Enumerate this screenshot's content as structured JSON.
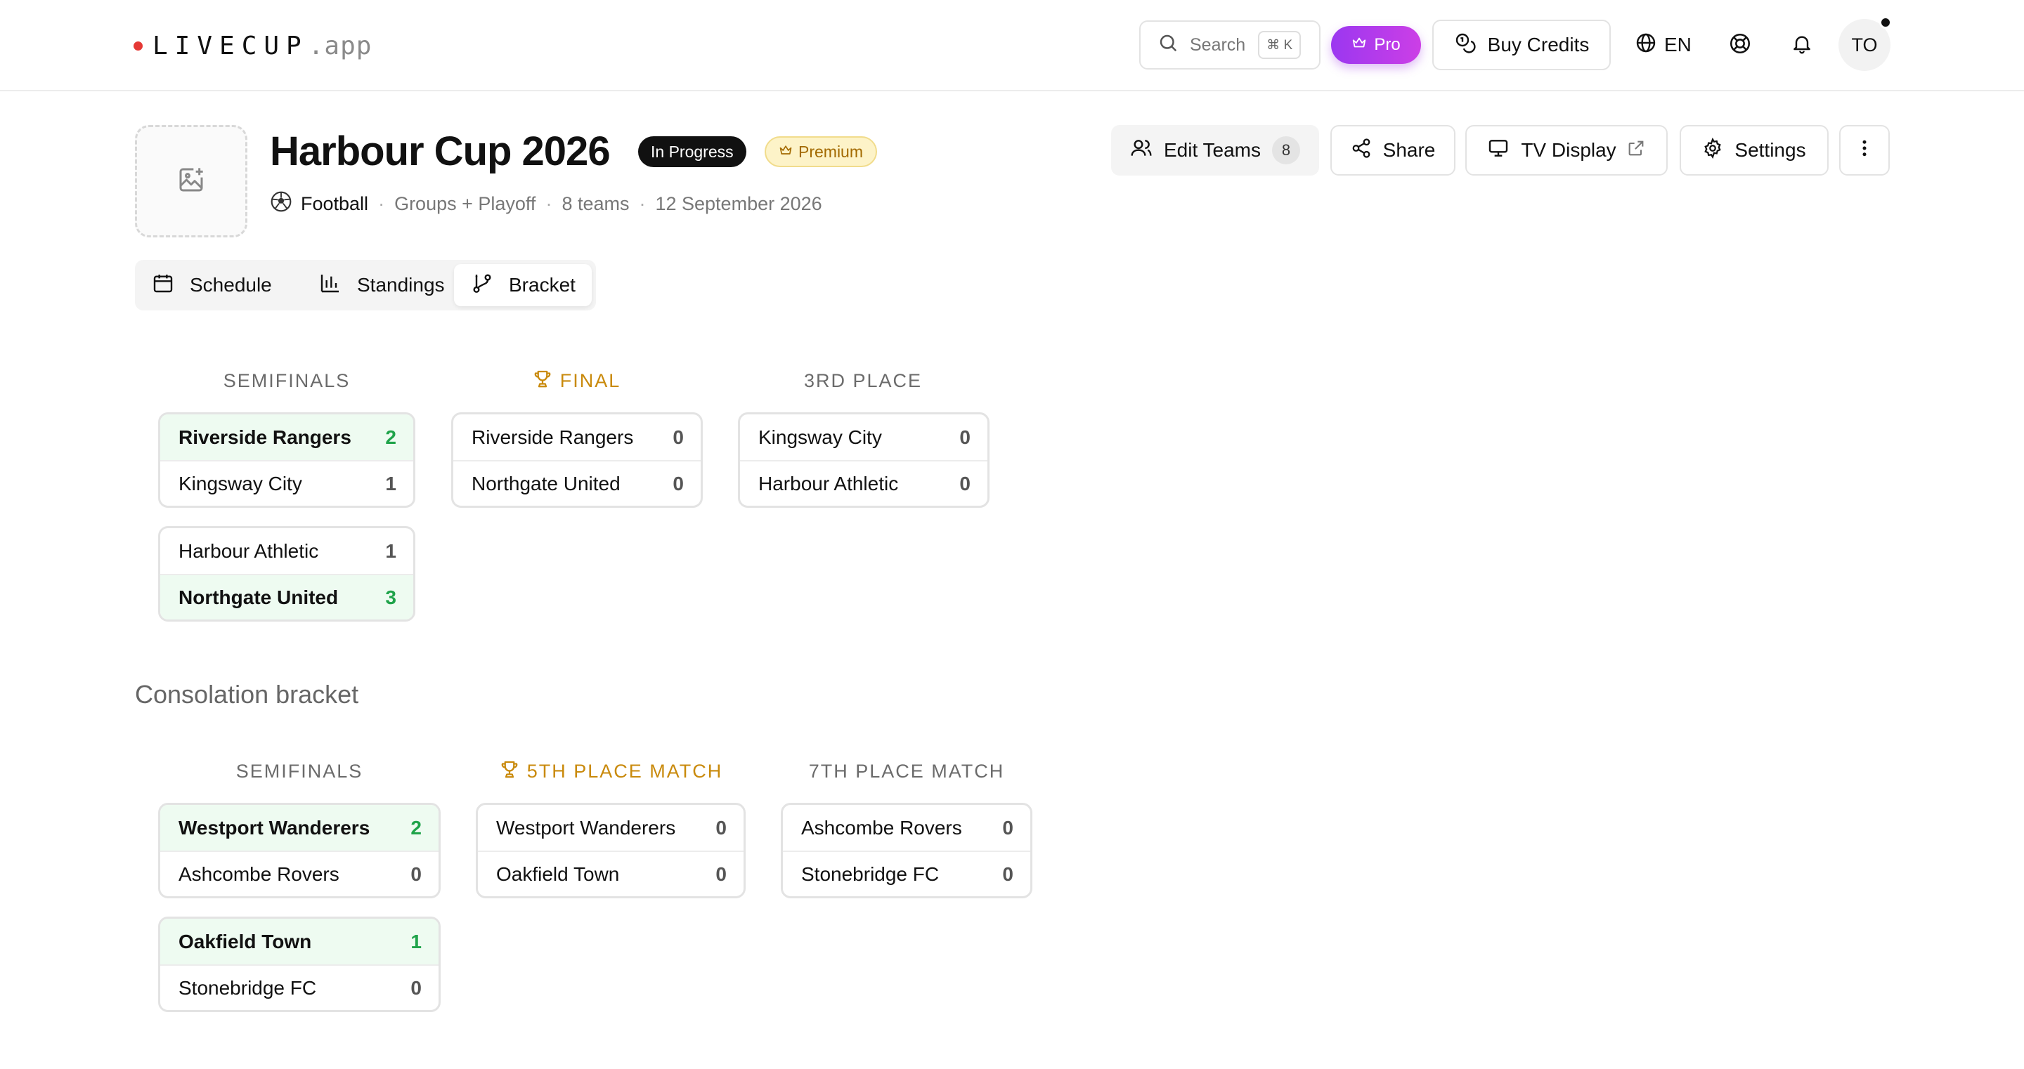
{
  "topbar": {
    "logo_main": "LIVECUP",
    "logo_sub": ".app",
    "search_placeholder": "Search",
    "search_shortcut": "⌘ K",
    "pro_label": "Pro",
    "buy_credits_label": "Buy Credits",
    "language": "EN",
    "avatar_initials": "TO"
  },
  "tournament": {
    "title": "Harbour Cup 2026",
    "status_badge": "In Progress",
    "tier_badge": "Premium",
    "sport": "Football",
    "format": "Groups + Playoff",
    "teams": "8 teams",
    "date": "12 September 2026"
  },
  "actions": {
    "edit_teams_label": "Edit Teams",
    "edit_teams_count": "8",
    "share_label": "Share",
    "tv_display_label": "TV Display",
    "settings_label": "Settings"
  },
  "tabs": [
    {
      "label": "Schedule",
      "active": false
    },
    {
      "label": "Standings",
      "active": false
    },
    {
      "label": "Bracket",
      "active": true
    }
  ],
  "main_bracket": {
    "rounds": [
      {
        "title": "SEMIFINALS",
        "matches": [
          {
            "teams": [
              {
                "name": "Riverside Rangers",
                "score": "2",
                "winner": true
              },
              {
                "name": "Kingsway City",
                "score": "1",
                "winner": false
              }
            ]
          },
          {
            "teams": [
              {
                "name": "Harbour Athletic",
                "score": "1",
                "winner": false
              },
              {
                "name": "Northgate United",
                "score": "3",
                "winner": true
              }
            ]
          }
        ]
      },
      {
        "title": "FINAL",
        "matches": [
          {
            "teams": [
              {
                "name": "Riverside Rangers",
                "score": "0",
                "winner": false
              },
              {
                "name": "Northgate United",
                "score": "0",
                "winner": false
              }
            ]
          }
        ]
      },
      {
        "title": "3RD PLACE",
        "matches": [
          {
            "teams": [
              {
                "name": "Kingsway City",
                "score": "0",
                "winner": false
              },
              {
                "name": "Harbour Athletic",
                "score": "0",
                "winner": false
              }
            ]
          }
        ]
      }
    ]
  },
  "consolation": {
    "title": "Consolation bracket",
    "rounds": [
      {
        "title": "SEMIFINALS",
        "matches": [
          {
            "teams": [
              {
                "name": "Westport Wanderers",
                "score": "2",
                "winner": true
              },
              {
                "name": "Ashcombe Rovers",
                "score": "0",
                "winner": false
              }
            ]
          },
          {
            "teams": [
              {
                "name": "Oakfield Town",
                "score": "1",
                "winner": true
              },
              {
                "name": "Stonebridge FC",
                "score": "0",
                "winner": false
              }
            ]
          }
        ]
      },
      {
        "title": "5TH PLACE MATCH",
        "matches": [
          {
            "teams": [
              {
                "name": "Westport Wanderers",
                "score": "0",
                "winner": false
              },
              {
                "name": "Oakfield Town",
                "score": "0",
                "winner": false
              }
            ]
          }
        ]
      },
      {
        "title": "7TH PLACE MATCH",
        "matches": [
          {
            "teams": [
              {
                "name": "Ashcombe Rovers",
                "score": "0",
                "winner": false
              },
              {
                "name": "Stonebridge FC",
                "score": "0",
                "winner": false
              }
            ]
          }
        ]
      }
    ]
  }
}
